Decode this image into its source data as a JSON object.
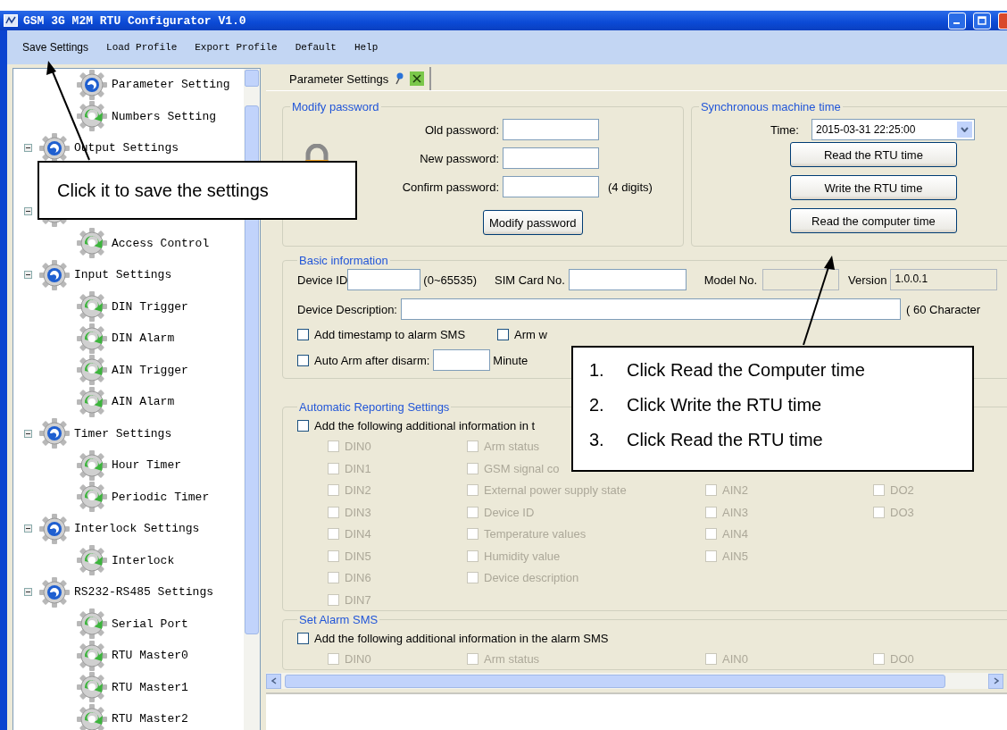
{
  "window": {
    "title": "GSM 3G M2M RTU Configurator V1.0"
  },
  "menu": [
    "Save Settings",
    "Load Profile",
    "Export Profile",
    "Default",
    "Help"
  ],
  "tree": {
    "continued_items": [
      {
        "label": "Parameter Setting",
        "kind": "swirl"
      },
      {
        "label": "Numbers Setting",
        "kind": "arrow"
      }
    ],
    "groups": [
      {
        "label": "Output Settings",
        "kind": "swirl",
        "expanded": true,
        "children": [
          {
            "kind": "covered"
          }
        ]
      },
      {
        "kind": "covered",
        "expanded": true,
        "children": [
          {
            "label": "Access Control",
            "kind": "arrow"
          }
        ]
      },
      {
        "label": "Input Settings",
        "kind": "swirl",
        "expanded": true,
        "children": [
          {
            "label": "DIN Trigger",
            "kind": "arrow"
          },
          {
            "label": "DIN Alarm",
            "kind": "arrow"
          },
          {
            "label": "AIN Trigger",
            "kind": "arrow"
          },
          {
            "label": "AIN Alarm",
            "kind": "arrow"
          }
        ]
      },
      {
        "label": "Timer Settings",
        "kind": "swirl",
        "expanded": true,
        "children": [
          {
            "label": "Hour Timer",
            "kind": "arrow"
          },
          {
            "label": "Periodic Timer",
            "kind": "arrow"
          }
        ]
      },
      {
        "label": "Interlock Settings",
        "kind": "swirl",
        "expanded": true,
        "children": [
          {
            "label": "Interlock",
            "kind": "arrow"
          }
        ]
      },
      {
        "label": "RS232-RS485 Settings",
        "kind": "swirl",
        "expanded": true,
        "children": [
          {
            "label": "Serial Port",
            "kind": "arrow"
          },
          {
            "label": "RTU Master0",
            "kind": "arrow"
          },
          {
            "label": "RTU Master1",
            "kind": "arrow"
          },
          {
            "label": "RTU Master2",
            "kind": "arrow"
          }
        ]
      }
    ]
  },
  "tabs": [
    {
      "label": "Parameter Settings",
      "selected": true
    }
  ],
  "modify_password": {
    "title": "Modify password",
    "fields": [
      {
        "label": "Old password:"
      },
      {
        "label": "New password:"
      },
      {
        "label": "Confirm password:",
        "hint": "(4 digits)"
      }
    ],
    "button": "Modify password"
  },
  "machine_time": {
    "title": "Synchronous machine time",
    "time_label": "Time:",
    "time_value": "2015-03-31 22:25:00",
    "buttons": [
      "Read the RTU time",
      "Write the RTU time",
      "Read the computer time"
    ]
  },
  "basic_information": {
    "title": "Basic information",
    "device_id": {
      "label": "Device ID",
      "hint": "(0~65535)"
    },
    "sim_card": {
      "label": "SIM Card No."
    },
    "model_no": {
      "label": "Model No.",
      "disabled": true
    },
    "version": {
      "label": "Version",
      "value": "1.0.0.1"
    },
    "description": {
      "label": "Device Description:",
      "hint": "( 60 Character"
    },
    "options": [
      {
        "label": "Add timestamp to alarm SMS",
        "checked": false,
        "disabled": false
      },
      {
        "label": "Arm w",
        "checked": false,
        "disabled": false
      }
    ],
    "auto_arm": {
      "label": "Auto Arm after disarm:",
      "checked": false,
      "disabled": false,
      "unit": "Minute"
    }
  },
  "automatic_reporting": {
    "title": "Automatic Reporting Settings",
    "master": {
      "label": "Add the following additional information in t",
      "checked": false,
      "disabled": false
    },
    "rows": [
      [
        {
          "label": "DIN0",
          "checked": false,
          "disabled": true
        },
        {
          "label": "Arm status",
          "checked": false,
          "disabled": true
        },
        null,
        null
      ],
      [
        {
          "label": "DIN1",
          "checked": false,
          "disabled": true
        },
        {
          "label": "GSM signal co",
          "checked": false,
          "disabled": true
        },
        null,
        null
      ],
      [
        {
          "label": "DIN2",
          "checked": false,
          "disabled": true
        },
        {
          "label": "External power supply state",
          "checked": false,
          "disabled": true
        },
        {
          "label": "AIN2",
          "checked": false,
          "disabled": true
        },
        {
          "label": "DO2",
          "checked": false,
          "disabled": true
        }
      ],
      [
        {
          "label": "DIN3",
          "checked": false,
          "disabled": true
        },
        {
          "label": "Device ID",
          "checked": false,
          "disabled": true
        },
        {
          "label": "AIN3",
          "checked": false,
          "disabled": true
        },
        {
          "label": "DO3",
          "checked": false,
          "disabled": true
        }
      ],
      [
        {
          "label": "DIN4",
          "checked": false,
          "disabled": true
        },
        {
          "label": "Temperature values",
          "checked": false,
          "disabled": true
        },
        {
          "label": "AIN4",
          "checked": false,
          "disabled": true
        },
        null
      ],
      [
        {
          "label": "DIN5",
          "checked": false,
          "disabled": true
        },
        {
          "label": "Humidity value",
          "checked": false,
          "disabled": true
        },
        {
          "label": "AIN5",
          "checked": false,
          "disabled": true
        },
        null
      ],
      [
        {
          "label": "DIN6",
          "checked": false,
          "disabled": true
        },
        {
          "label": "Device description",
          "checked": false,
          "disabled": true
        },
        null,
        null
      ],
      [
        {
          "label": "DIN7",
          "checked": false,
          "disabled": true
        },
        null,
        null,
        null
      ]
    ]
  },
  "alarm_sms": {
    "title": "Set Alarm SMS",
    "master": {
      "label": "Add the following additional information in the alarm SMS",
      "checked": false,
      "disabled": false
    },
    "rows": [
      [
        {
          "label": "DIN0",
          "checked": false,
          "disabled": true
        },
        {
          "label": "Arm status",
          "checked": false,
          "disabled": true
        },
        {
          "label": "AIN0",
          "checked": false,
          "disabled": true
        },
        {
          "label": "DO0",
          "checked": false,
          "disabled": true
        }
      ]
    ]
  },
  "callouts": [
    {
      "kind": "note",
      "text": "Click it to save the settings"
    },
    {
      "kind": "steps",
      "steps": [
        {
          "number": "1.",
          "text": "Click Read the Computer time"
        },
        {
          "number": "2.",
          "text": "Click Write the RTU time"
        },
        {
          "number": "3.",
          "text": "Click Read the RTU time"
        }
      ]
    }
  ]
}
